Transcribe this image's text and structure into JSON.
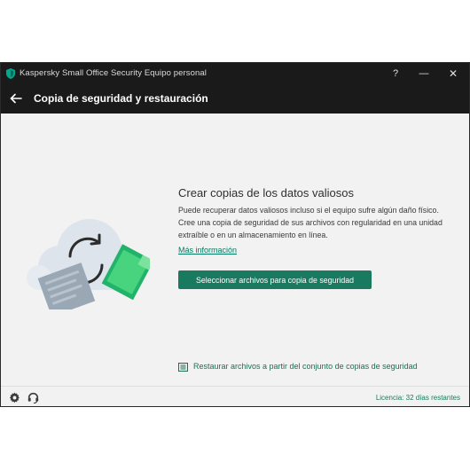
{
  "window": {
    "app_title": "Kaspersky Small Office Security Equipo personal",
    "help_label": "?",
    "minimize_label": "—",
    "close_label": "✕"
  },
  "header": {
    "title": "Copia de seguridad y restauración",
    "back_icon": "arrow-left-icon"
  },
  "content": {
    "title": "Crear copias de los datos valiosos",
    "description": "Puede recuperar datos valiosos incluso si el equipo sufre algún daño físico. Cree una copia de seguridad de sus archivos con regularidad en una unidad extraíble o en un almacenamiento en línea.",
    "more_info_link": "Más información",
    "select_files_button": "Seleccionar archivos para copia de seguridad",
    "restore_link": "Restaurar archivos a partir del conjunto de copias de seguridad"
  },
  "footer": {
    "license_text": "Licencia: 32 días restantes",
    "settings_icon": "gear-icon",
    "support_icon": "support-icon"
  },
  "colors": {
    "titlebar_bg": "#1a1a1a",
    "accent": "#1a7a5f",
    "link": "#007a5e",
    "content_bg": "#f2f2f2"
  }
}
